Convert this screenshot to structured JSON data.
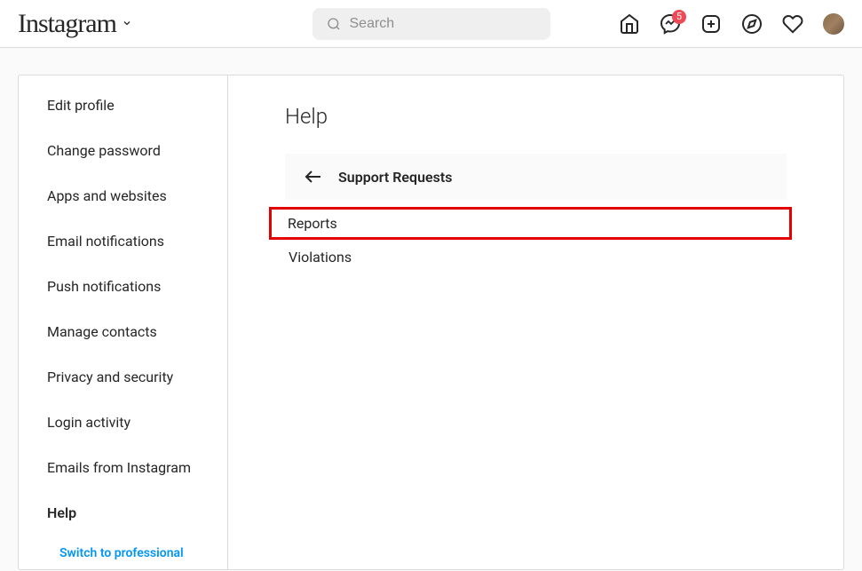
{
  "header": {
    "logo_text": "Instagram",
    "search_placeholder": "Search",
    "messenger_badge": "5"
  },
  "sidebar": {
    "items": [
      {
        "label": "Edit profile",
        "active": false
      },
      {
        "label": "Change password",
        "active": false
      },
      {
        "label": "Apps and websites",
        "active": false
      },
      {
        "label": "Email notifications",
        "active": false
      },
      {
        "label": "Push notifications",
        "active": false
      },
      {
        "label": "Manage contacts",
        "active": false
      },
      {
        "label": "Privacy and security",
        "active": false
      },
      {
        "label": "Login activity",
        "active": false
      },
      {
        "label": "Emails from Instagram",
        "active": false
      },
      {
        "label": "Help",
        "active": true
      }
    ],
    "switch_label": "Switch to professional"
  },
  "main": {
    "title": "Help",
    "section_title": "Support Requests",
    "options": [
      {
        "label": "Reports",
        "highlighted": true
      },
      {
        "label": "Violations",
        "highlighted": false
      }
    ]
  }
}
